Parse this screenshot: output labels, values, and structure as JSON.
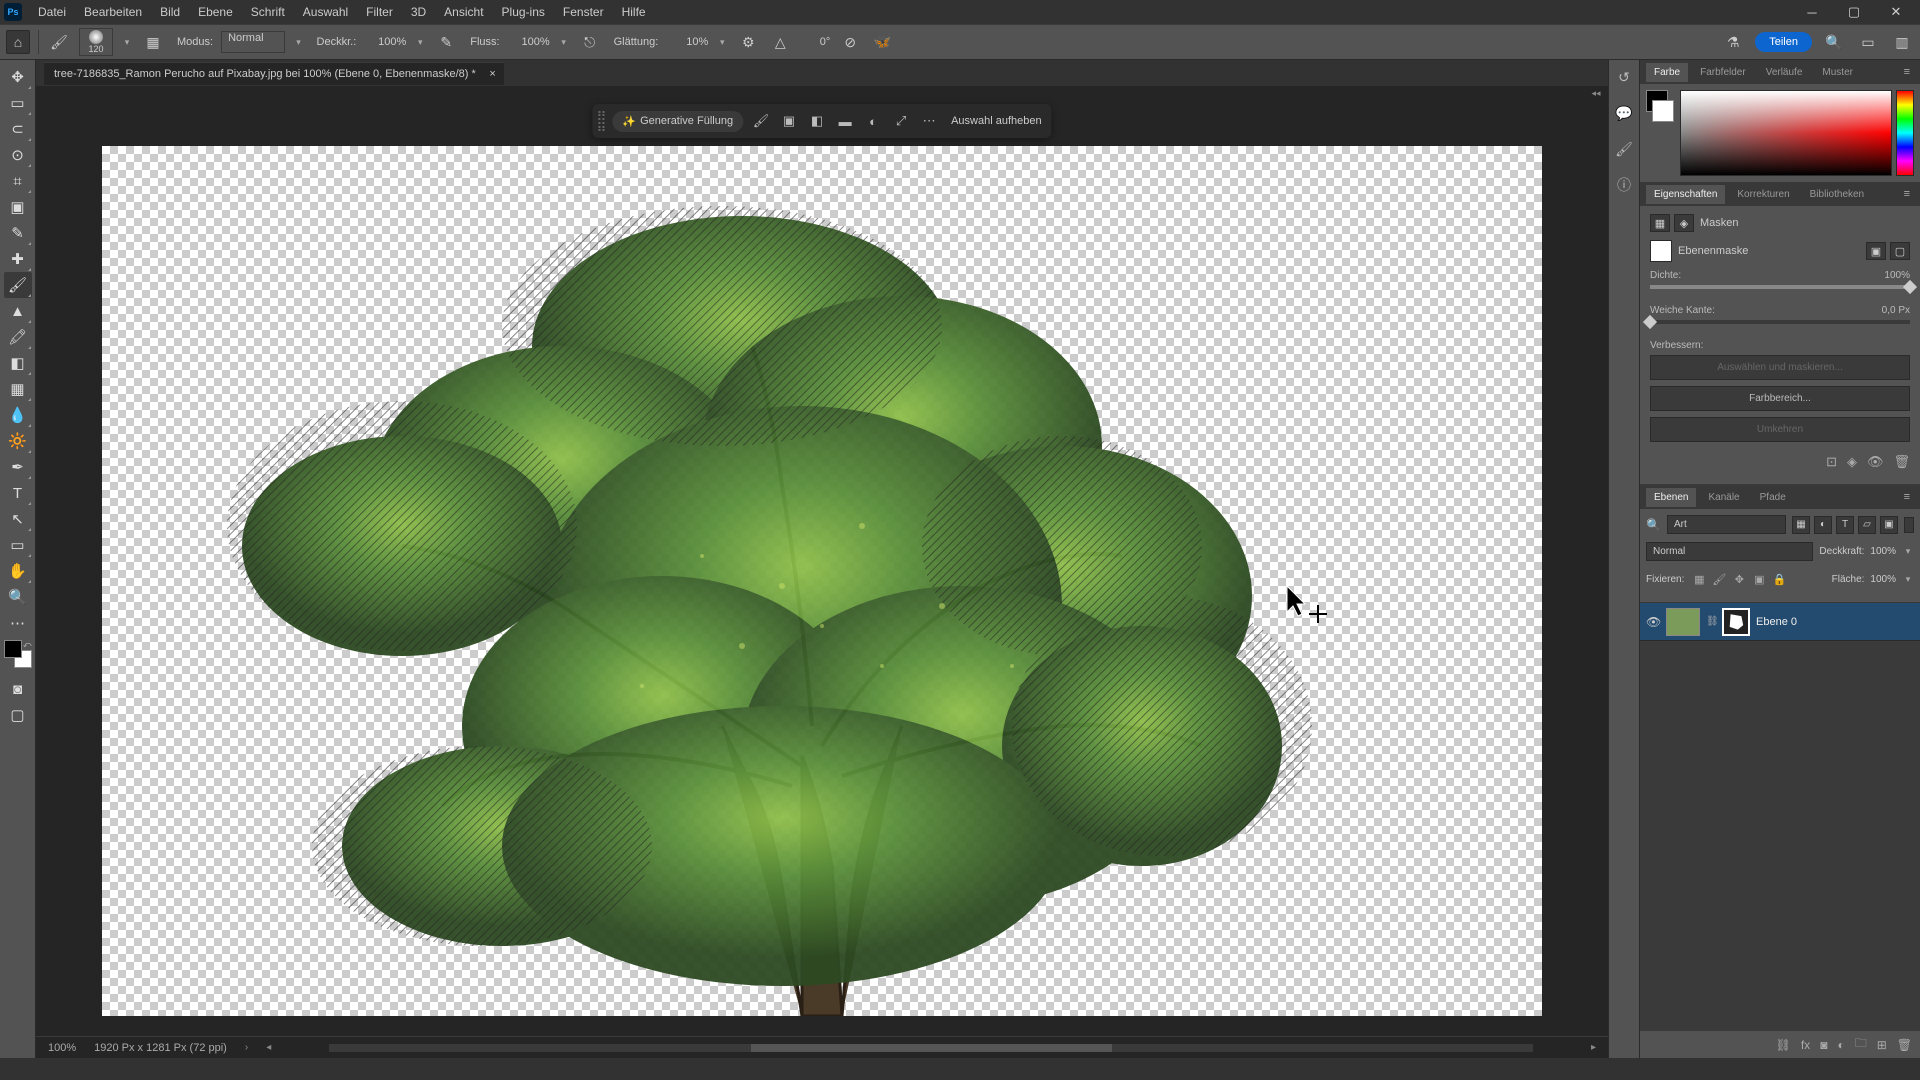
{
  "menubar": [
    "Datei",
    "Bearbeiten",
    "Bild",
    "Ebene",
    "Schrift",
    "Auswahl",
    "Filter",
    "3D",
    "Ansicht",
    "Plug-ins",
    "Fenster",
    "Hilfe"
  ],
  "options": {
    "brush_size": "120",
    "mode_label": "Modus:",
    "mode_value": "Normal",
    "opacity_label": "Deckkr.:",
    "opacity_value": "100%",
    "flow_label": "Fluss:",
    "flow_value": "100%",
    "smoothing_label": "Glättung:",
    "smoothing_value": "10%",
    "angle_value": "0°",
    "share_label": "Teilen"
  },
  "document": {
    "tab_title": "tree-7186835_Ramon Perucho auf Pixabay.jpg bei 100% (Ebene 0, Ebenenmaske/8) *"
  },
  "float_bar": {
    "gen_fill": "Generative Füllung",
    "deselect": "Auswahl aufheben"
  },
  "color_tabs": [
    "Farbe",
    "Farbfelder",
    "Verläufe",
    "Muster"
  ],
  "prop_tabs": [
    "Eigenschaften",
    "Korrekturen",
    "Bibliotheken"
  ],
  "properties": {
    "header": "Masken",
    "mask_label": "Ebenenmaske",
    "density_label": "Dichte:",
    "density_value": "100%",
    "feather_label": "Weiche Kante:",
    "feather_value": "0,0 Px",
    "improve_label": "Verbessern:",
    "select_mask": "Auswählen und maskieren...",
    "color_range": "Farbbereich...",
    "invert": "Umkehren"
  },
  "layer_tabs": [
    "Ebenen",
    "Kanäle",
    "Pfade"
  ],
  "layers": {
    "filter_label": "Art",
    "blend_mode": "Normal",
    "opacity_label": "Deckkraft:",
    "opacity_value": "100%",
    "lock_label": "Fixieren:",
    "fill_label": "Fläche:",
    "fill_value": "100%",
    "layer0_name": "Ebene 0"
  },
  "status": {
    "zoom": "100%",
    "dims": "1920 Px x 1281 Px (72 ppi)"
  }
}
